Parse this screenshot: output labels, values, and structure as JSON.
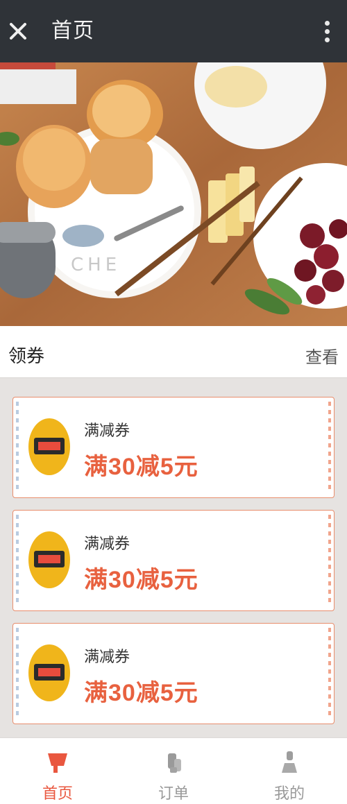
{
  "header": {
    "title": "首页",
    "close_icon": "close-icon",
    "menu_icon": "more-vertical-icon"
  },
  "banner": {
    "alt": "food photo banner"
  },
  "info": {
    "left": "领券",
    "right": "查看"
  },
  "coupons": [
    {
      "title": "满减券",
      "value": "满30减5元",
      "logo_icon": "coupon-logo-icon"
    },
    {
      "title": "满减券",
      "value": "满30减5元",
      "logo_icon": "coupon-logo-icon"
    },
    {
      "title": "满减券",
      "value": "满30减5元",
      "logo_icon": "coupon-logo-icon"
    }
  ],
  "bottom_nav": {
    "items": [
      {
        "label": "首页",
        "icon": "home-icon"
      },
      {
        "label": "订单",
        "icon": "orders-icon"
      },
      {
        "label": "我的",
        "icon": "profile-icon"
      }
    ]
  },
  "colors": {
    "topbar": "#2f3338",
    "accent": "#e9573f",
    "coupon_border": "#e88d6c",
    "background": "#e6e3e1"
  }
}
